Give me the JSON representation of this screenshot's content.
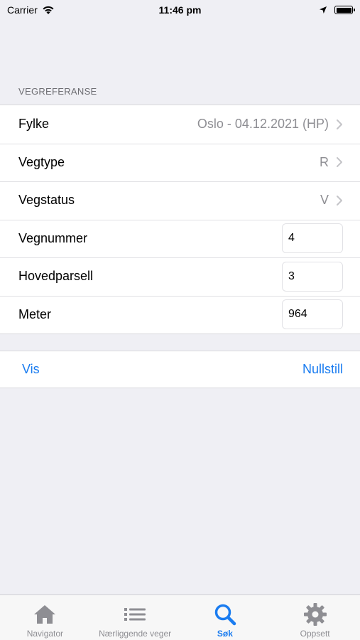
{
  "status_bar": {
    "carrier": "Carrier",
    "time": "11:46 pm"
  },
  "section": {
    "header": "VEGREFERANSE"
  },
  "rows": [
    {
      "label": "Fylke",
      "value": "Oslo - 04.12.2021 (HP)",
      "kind": "disclosure"
    },
    {
      "label": "Vegtype",
      "value": "R",
      "kind": "disclosure"
    },
    {
      "label": "Vegstatus",
      "value": "V",
      "kind": "disclosure"
    },
    {
      "label": "Vegnummer",
      "value": "4",
      "kind": "input"
    },
    {
      "label": "Hovedparsell",
      "value": "3",
      "kind": "input"
    },
    {
      "label": "Meter",
      "value": "964",
      "kind": "input"
    }
  ],
  "actions": {
    "show_label": "Vis",
    "reset_label": "Nullstill"
  },
  "tabs": [
    {
      "label": "Navigator",
      "icon": "house-icon",
      "active": false
    },
    {
      "label": "Nærliggende veger",
      "icon": "list-icon",
      "active": false
    },
    {
      "label": "Søk",
      "icon": "magnifier-icon",
      "active": true
    },
    {
      "label": "Oppsett",
      "icon": "gear-icon",
      "active": false
    }
  ],
  "colors": {
    "accent": "#1a7cf0",
    "background": "#efeff4",
    "inactive_tab": "#8e8e93"
  }
}
